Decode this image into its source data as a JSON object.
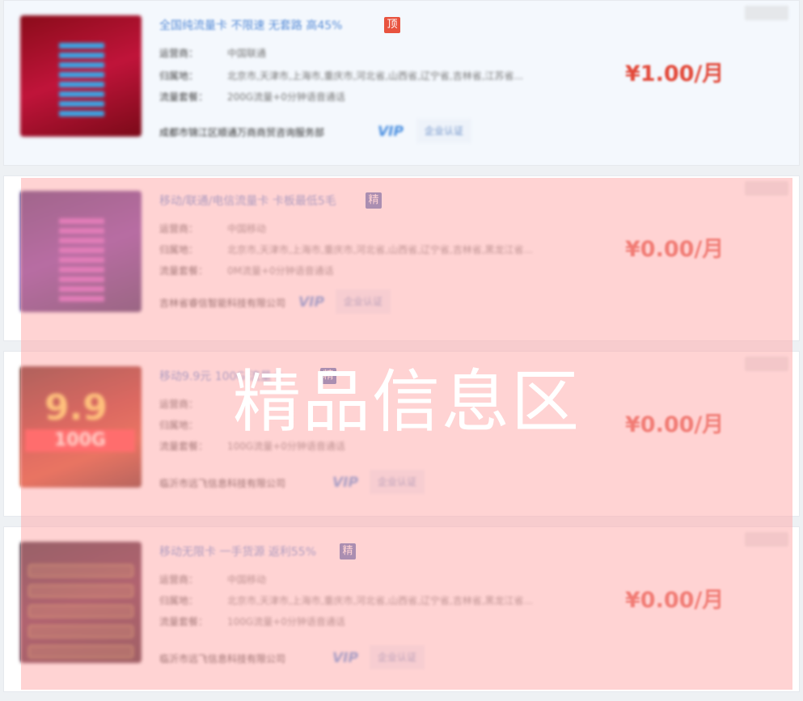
{
  "listings": [
    {
      "title": "全国纯流量卡 不限速 无套路 高45%",
      "badge": "顶",
      "labels": {
        "operator": "运营商：",
        "region": "归属地：",
        "package": "流量套餐："
      },
      "operator": "中国联通",
      "region": "北京市,天津市,上海市,重庆市,河北省,山西省,辽宁省,吉林省,江苏省...",
      "package": "200G流量+0分钟语音通话",
      "company": "成都市锦江区顺通万商商贸咨询服务部",
      "vip": "VIP",
      "cert": "企业认证",
      "price": "¥1.00/月"
    },
    {
      "title": "移动/联通/电信流量卡 卡板最低5毛",
      "badge": "精",
      "labels": {
        "operator": "运营商：",
        "region": "归属地：",
        "package": "流量套餐："
      },
      "operator": "中国移动",
      "region": "北京市,天津市,上海市,重庆市,河北省,山西省,辽宁省,吉林省,黑龙江省...",
      "package": "0M流量+0分钟语音通话",
      "company": "吉林省睿信智能科技有限公司",
      "vip": "VIP",
      "cert": "企业认证",
      "price": "¥0.00/月"
    },
    {
      "title": "移动9.9元 100G 流量卡",
      "badge": "精",
      "labels": {
        "operator": "运营商：",
        "region": "归属地：",
        "package": "流量套餐："
      },
      "operator": "",
      "region": "",
      "package": "100G流量+0分钟语音通话",
      "company": "临沂市远飞信息科技有限公司",
      "vip": "VIP",
      "cert": "企业认证",
      "price": "¥0.00/月"
    },
    {
      "title": "移动无限卡 一手货源 返利55%",
      "badge": "精",
      "labels": {
        "operator": "运营商：",
        "region": "归属地：",
        "package": "流量套餐："
      },
      "operator": "中国移动",
      "region": "北京市,天津市,上海市,重庆市,河北省,山西省,辽宁省,吉林省,黑龙江省...",
      "package": "100G流量+0分钟语音通话",
      "company": "临沂市远飞信息科技有限公司",
      "vip": "VIP",
      "cert": "企业认证",
      "price": "¥0.00/月"
    }
  ],
  "thumbnails": {
    "third": {
      "big": "9.9",
      "bar": "100G"
    }
  },
  "overlay": {
    "text": "精品信息区"
  }
}
